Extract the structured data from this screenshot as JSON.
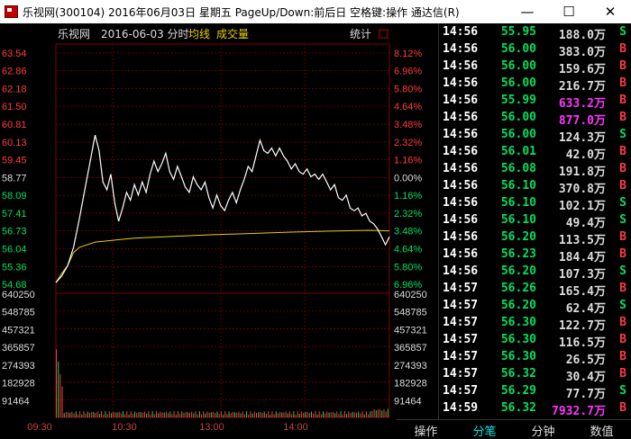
{
  "window": {
    "title": "乐视网(300104) 2016年06月03日 星期五 PageUp/Down:前后日 空格键:操作 通达信(R)",
    "minimize": "—",
    "maximize": "☐",
    "close": "✕"
  },
  "chart": {
    "stock_name": "乐视网",
    "date": "2016-06-03 分时",
    "avg_label": "均线",
    "vol_label": "成交量",
    "stats_label": "统计"
  },
  "chart_data": {
    "type": "line",
    "prev_close": 58.77,
    "price_ticks": [
      "63.54",
      "62.86",
      "62.18",
      "61.50",
      "60.81",
      "60.13",
      "59.45",
      "58.77",
      "58.09",
      "57.41",
      "56.73",
      "56.04",
      "55.36",
      "54.68"
    ],
    "pct_ticks": [
      "8.12%",
      "6.96%",
      "5.80%",
      "4.64%",
      "3.48%",
      "2.32%",
      "1.16%",
      "0.00%",
      "1.16%",
      "2.32%",
      "3.48%",
      "4.64%",
      "5.80%",
      "6.96%"
    ],
    "volume_ticks": [
      "640250",
      "548785",
      "457321",
      "365857",
      "274393",
      "182928",
      "91464"
    ],
    "time_ticks": [
      "09:30",
      "10:30",
      "13:00",
      "14:00"
    ],
    "price_series": [
      [
        0,
        54.75
      ],
      [
        3,
        55.0
      ],
      [
        6,
        55.4
      ],
      [
        9,
        56.1
      ],
      [
        12,
        57.2
      ],
      [
        15,
        58.4
      ],
      [
        18,
        59.6
      ],
      [
        20,
        60.4
      ],
      [
        22,
        59.8
      ],
      [
        24,
        58.6
      ],
      [
        26,
        58.3
      ],
      [
        28,
        58.9
      ],
      [
        30,
        57.8
      ],
      [
        32,
        57.1
      ],
      [
        34,
        57.6
      ],
      [
        36,
        58.2
      ],
      [
        38,
        57.9
      ],
      [
        40,
        58.5
      ],
      [
        42,
        58.1
      ],
      [
        44,
        58.6
      ],
      [
        46,
        58.2
      ],
      [
        48,
        58.9
      ],
      [
        50,
        59.4
      ],
      [
        52,
        59.0
      ],
      [
        54,
        59.3
      ],
      [
        56,
        59.7
      ],
      [
        58,
        59.0
      ],
      [
        60,
        58.7
      ],
      [
        62,
        59.2
      ],
      [
        64,
        58.8
      ],
      [
        66,
        58.4
      ],
      [
        68,
        58.2
      ],
      [
        70,
        58.8
      ],
      [
        72,
        58.5
      ],
      [
        74,
        58.3
      ],
      [
        76,
        58.6
      ],
      [
        78,
        58.0
      ],
      [
        80,
        57.6
      ],
      [
        82,
        58.1
      ],
      [
        84,
        57.7
      ],
      [
        86,
        57.5
      ],
      [
        88,
        57.9
      ],
      [
        90,
        58.2
      ],
      [
        92,
        57.8
      ],
      [
        94,
        58.3
      ],
      [
        96,
        58.7
      ],
      [
        98,
        59.2
      ],
      [
        100,
        59.0
      ],
      [
        102,
        59.6
      ],
      [
        104,
        60.2
      ],
      [
        106,
        59.8
      ],
      [
        108,
        59.7
      ],
      [
        110,
        59.9
      ],
      [
        112,
        59.6
      ],
      [
        114,
        59.9
      ],
      [
        116,
        59.6
      ],
      [
        118,
        59.4
      ],
      [
        120,
        59.1
      ],
      [
        122,
        59.3
      ],
      [
        124,
        59.0
      ],
      [
        126,
        58.9
      ],
      [
        128,
        59.1
      ],
      [
        130,
        58.8
      ],
      [
        132,
        58.9
      ],
      [
        134,
        58.7
      ],
      [
        136,
        58.9
      ],
      [
        138,
        58.6
      ],
      [
        140,
        58.3
      ],
      [
        142,
        58.5
      ],
      [
        144,
        58.0
      ],
      [
        146,
        57.9
      ],
      [
        148,
        58.1
      ],
      [
        150,
        57.6
      ],
      [
        152,
        57.5
      ],
      [
        154,
        57.6
      ],
      [
        156,
        57.3
      ],
      [
        158,
        57.4
      ],
      [
        160,
        57.1
      ],
      [
        162,
        57.0
      ],
      [
        164,
        56.8
      ],
      [
        166,
        56.5
      ],
      [
        168,
        56.2
      ],
      [
        170,
        56.5
      ]
    ],
    "avg_series": [
      [
        0,
        54.75
      ],
      [
        3,
        55.1
      ],
      [
        6,
        55.4
      ],
      [
        9,
        55.9
      ],
      [
        12,
        56.1
      ],
      [
        20,
        56.3
      ],
      [
        40,
        56.45
      ],
      [
        60,
        56.52
      ],
      [
        80,
        56.58
      ],
      [
        100,
        56.63
      ],
      [
        120,
        56.68
      ],
      [
        140,
        56.72
      ],
      [
        160,
        56.75
      ],
      [
        170,
        56.73
      ]
    ]
  },
  "ticks": [
    {
      "time": "14:56",
      "price": "55.95",
      "vol": "188.0",
      "bs": "S",
      "big": false
    },
    {
      "time": "14:56",
      "price": "56.00",
      "vol": "383.0",
      "bs": "B",
      "big": false
    },
    {
      "time": "14:56",
      "price": "56.00",
      "vol": "159.6",
      "bs": "B",
      "big": false
    },
    {
      "time": "14:56",
      "price": "56.00",
      "vol": "216.7",
      "bs": "B",
      "big": false
    },
    {
      "time": "14:56",
      "price": "55.99",
      "vol": "633.2",
      "bs": "B",
      "big": true
    },
    {
      "time": "14:56",
      "price": "56.00",
      "vol": "877.0",
      "bs": "B",
      "big": true
    },
    {
      "time": "14:56",
      "price": "56.00",
      "vol": "124.3",
      "bs": "S",
      "big": false
    },
    {
      "time": "14:56",
      "price": "56.01",
      "vol": "42.0",
      "bs": "B",
      "big": false
    },
    {
      "time": "14:56",
      "price": "56.08",
      "vol": "191.8",
      "bs": "B",
      "big": false
    },
    {
      "time": "14:56",
      "price": "56.10",
      "vol": "370.8",
      "bs": "B",
      "big": false
    },
    {
      "time": "14:56",
      "price": "56.10",
      "vol": "102.1",
      "bs": "S",
      "big": false
    },
    {
      "time": "14:56",
      "price": "56.10",
      "vol": "49.4",
      "bs": "S",
      "big": false
    },
    {
      "time": "14:56",
      "price": "56.20",
      "vol": "113.5",
      "bs": "B",
      "big": false
    },
    {
      "time": "14:56",
      "price": "56.23",
      "vol": "184.4",
      "bs": "B",
      "big": false
    },
    {
      "time": "14:56",
      "price": "56.20",
      "vol": "107.3",
      "bs": "S",
      "big": false
    },
    {
      "time": "14:57",
      "price": "56.26",
      "vol": "165.4",
      "bs": "B",
      "big": false
    },
    {
      "time": "14:57",
      "price": "56.20",
      "vol": "62.4",
      "bs": "S",
      "big": false
    },
    {
      "time": "14:57",
      "price": "56.30",
      "vol": "122.7",
      "bs": "B",
      "big": false
    },
    {
      "time": "14:57",
      "price": "56.30",
      "vol": "116.5",
      "bs": "B",
      "big": false
    },
    {
      "time": "14:57",
      "price": "56.30",
      "vol": "26.5",
      "bs": "B",
      "big": false
    },
    {
      "time": "14:57",
      "price": "56.32",
      "vol": "30.4",
      "bs": "B",
      "big": false
    },
    {
      "time": "14:57",
      "price": "56.29",
      "vol": "77.7",
      "bs": "S",
      "big": false
    },
    {
      "time": "14:59",
      "price": "56.32",
      "vol": "7932.7",
      "bs": "B",
      "big": true
    }
  ],
  "unit": "万",
  "tabs": [
    "操作",
    "分笔",
    "分钟",
    "数值"
  ],
  "colors": {
    "up": "#ff3b3b",
    "down": "#00e060",
    "grid": "#800000",
    "price_line": "#ffffff",
    "avg_line": "#e8d000"
  }
}
